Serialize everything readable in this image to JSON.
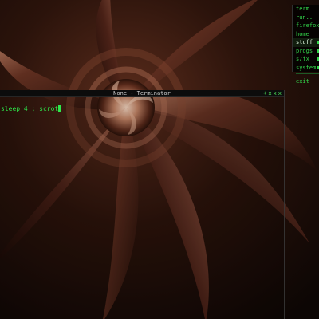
{
  "menu": {
    "items": [
      {
        "label": "term",
        "submenu": false
      },
      {
        "label": "run..",
        "submenu": false
      },
      {
        "label": "firefox",
        "submenu": false
      },
      {
        "label": "home",
        "submenu": false
      },
      {
        "label": "stuff",
        "submenu": true
      },
      {
        "label": "progs",
        "submenu": true
      },
      {
        "label": "s/fx",
        "submenu": true
      },
      {
        "label": "system",
        "submenu": true
      },
      {
        "label": "exit",
        "submenu": false
      }
    ],
    "selected_index": 4
  },
  "terminal": {
    "title": "None - Terminator",
    "controls": [
      "+",
      "x",
      "x",
      "x"
    ],
    "command": "sleep 4 ; scrot"
  },
  "colors": {
    "menu_text": "#33d44a",
    "terminal_text": "#2de84a",
    "accent": "#4fe05b"
  }
}
